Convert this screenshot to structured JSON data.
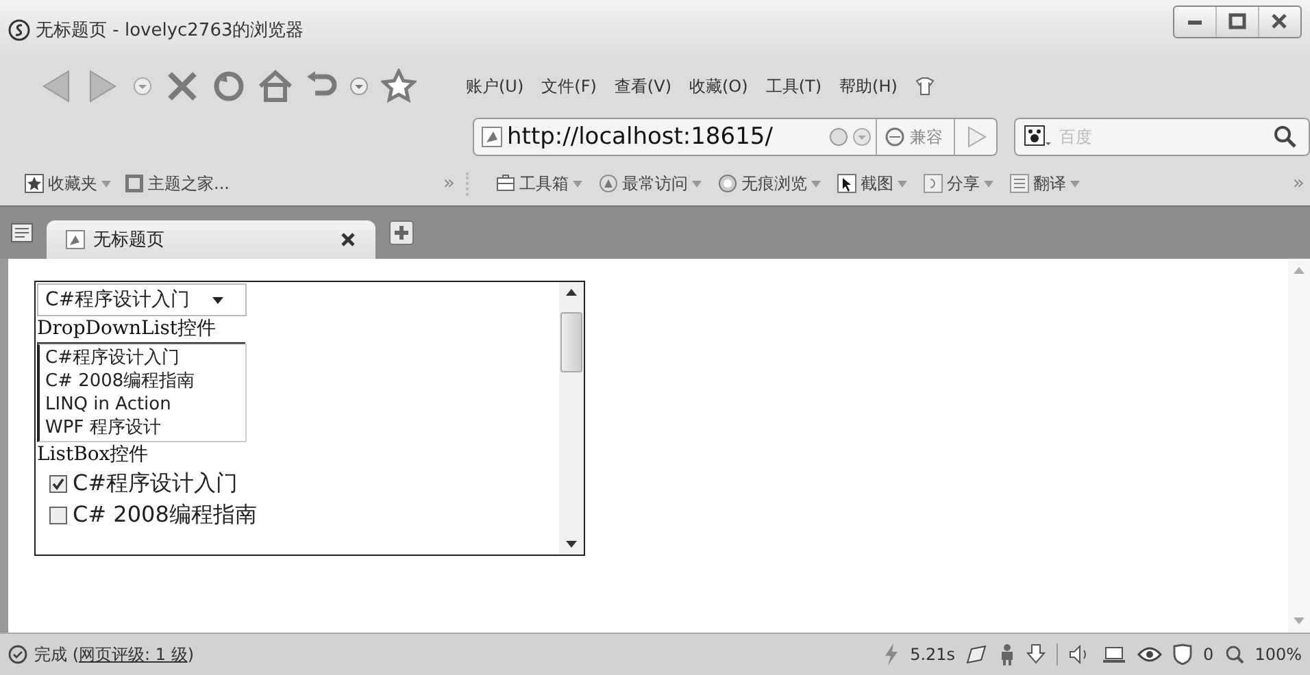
{
  "window": {
    "title": "无标题页 - lovelyc2763的浏览器"
  },
  "menu": [
    {
      "label": "账户(U)"
    },
    {
      "label": "文件(F)"
    },
    {
      "label": "查看(V)"
    },
    {
      "label": "收藏(O)"
    },
    {
      "label": "工具(T)"
    },
    {
      "label": "帮助(H)"
    }
  ],
  "address": {
    "value": "http://localhost:18615/",
    "compat": "兼容"
  },
  "search": {
    "placeholder": "百度"
  },
  "favorites": [
    {
      "label": "收藏夹",
      "dropdown": true
    },
    {
      "label": "主题之家...",
      "dropdown": false
    }
  ],
  "more": "»",
  "tools": [
    {
      "label": "工具箱"
    },
    {
      "label": "最常访问"
    },
    {
      "label": "无痕浏览"
    },
    {
      "label": "截图"
    },
    {
      "label": "分享"
    },
    {
      "label": "翻译"
    }
  ],
  "tabs": [
    {
      "label": "无标题页",
      "selected": true
    }
  ],
  "page": {
    "dropdown": {
      "value": "C#程序设计入门"
    },
    "dropdown_label": "DropDownList控件",
    "listbox": {
      "items": [
        "C#程序设计入门",
        "C# 2008编程指南",
        "LINQ in Action",
        "WPF 程序设计"
      ]
    },
    "listbox_label": "ListBox控件",
    "checkboxes": [
      {
        "label": "C#程序设计入门",
        "checked": true
      },
      {
        "label": "C# 2008编程指南",
        "checked": false
      }
    ]
  },
  "status_bar": {
    "status": "完成 (",
    "rating": "网页评级: 1 级",
    "status_end": ")",
    "load_time": "5.21s",
    "blocked": "0",
    "zoom": "100%"
  }
}
